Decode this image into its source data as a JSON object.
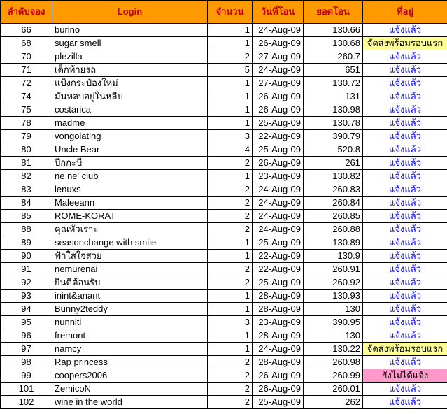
{
  "headers": {
    "order": "ลำดับจอง",
    "login": "Login",
    "qty": "จำนวน",
    "date": "วันที่โอน",
    "amount": "ยอดโอน",
    "status": "ที่อยู่"
  },
  "colors": {
    "header_bg": "#ff9900",
    "header_text": "#c00000",
    "status_text": "#0000ff",
    "pending_bg": "#ffff99",
    "unreported_bg": "#ff99cc"
  },
  "rows": [
    {
      "order": "66",
      "login": "burino",
      "qty": "1",
      "date": "24-Aug-09",
      "amount": "130.66",
      "status": "แจ้งแล้ว",
      "flag": ""
    },
    {
      "order": "68",
      "login": "sugar smell",
      "qty": "1",
      "date": "26-Aug-09",
      "amount": "130.68",
      "status": "จัดส่งพร้อมรอบแรก",
      "flag": "pending"
    },
    {
      "order": "70",
      "login": "plezilla",
      "qty": "2",
      "date": "27-Aug-09",
      "amount": "260.7",
      "status": "แจ้งแล้ว",
      "flag": ""
    },
    {
      "order": "71",
      "login": "เด็กท้ายรถ",
      "qty": "5",
      "date": "24-Aug-09",
      "amount": "651",
      "status": "แจ้งแล้ว",
      "flag": ""
    },
    {
      "order": "72",
      "login": "แป้งกระป๋องใหม่",
      "qty": "1",
      "date": "27-Aug-09",
      "amount": "130.72",
      "status": "แจ้งแล้ว",
      "flag": ""
    },
    {
      "order": "74",
      "login": "มันหลบอยู่ในหลืบ",
      "qty": "1",
      "date": "26-Aug-09",
      "amount": "131",
      "status": "แจ้งแล้ว",
      "flag": ""
    },
    {
      "order": "75",
      "login": "costarica",
      "qty": "1",
      "date": "26-Aug-09",
      "amount": "130.98",
      "status": "แจ้งแล้ว",
      "flag": ""
    },
    {
      "order": "78",
      "login": "madme",
      "qty": "1",
      "date": "25-Aug-09",
      "amount": "130.78",
      "status": "แจ้งแล้ว",
      "flag": ""
    },
    {
      "order": "79",
      "login": "vongolating",
      "qty": "3",
      "date": "22-Aug-09",
      "amount": "390.79",
      "status": "แจ้งแล้ว",
      "flag": ""
    },
    {
      "order": "80",
      "login": "Uncle Bear",
      "qty": "4",
      "date": "25-Aug-09",
      "amount": "520.8",
      "status": "แจ้งแล้ว",
      "flag": ""
    },
    {
      "order": "81",
      "login": "ปีกกะบี",
      "qty": "2",
      "date": "26-Aug-09",
      "amount": "261",
      "status": "แจ้งแล้ว",
      "flag": ""
    },
    {
      "order": "82",
      "login": "ne ne' club",
      "qty": "1",
      "date": "23-Aug-09",
      "amount": "130.82",
      "status": "แจ้งแล้ว",
      "flag": ""
    },
    {
      "order": "83",
      "login": "lenuxs",
      "qty": "2",
      "date": "24-Aug-09",
      "amount": "260.83",
      "status": "แจ้งแล้ว",
      "flag": ""
    },
    {
      "order": "84",
      "login": "Maleeann",
      "qty": "2",
      "date": "24-Aug-09",
      "amount": "260.84",
      "status": "แจ้งแล้ว",
      "flag": ""
    },
    {
      "order": "85",
      "login": "ROME-KORAT",
      "qty": "2",
      "date": "24-Aug-09",
      "amount": "260.85",
      "status": "แจ้งแล้ว",
      "flag": ""
    },
    {
      "order": "88",
      "login": "คุณหัวเราะ",
      "qty": "2",
      "date": "24-Aug-09",
      "amount": "260.88",
      "status": "แจ้งแล้ว",
      "flag": ""
    },
    {
      "order": "89",
      "login": "seasonchange with smile",
      "qty": "1",
      "date": "25-Aug-09",
      "amount": "130.89",
      "status": "แจ้งแล้ว",
      "flag": ""
    },
    {
      "order": "90",
      "login": "ฟ้าใสใจสวย",
      "qty": "1",
      "date": "22-Aug-09",
      "amount": "130.9",
      "status": "แจ้งแล้ว",
      "flag": ""
    },
    {
      "order": "91",
      "login": "nemurenai",
      "qty": "2",
      "date": "22-Aug-09",
      "amount": "260.91",
      "status": "แจ้งแล้ว",
      "flag": ""
    },
    {
      "order": "92",
      "login": "ยินดีต้อนรับ",
      "qty": "2",
      "date": "25-Aug-09",
      "amount": "260.92",
      "status": "แจ้งแล้ว",
      "flag": ""
    },
    {
      "order": "93",
      "login": "inint&anant",
      "qty": "1",
      "date": "28-Aug-09",
      "amount": "130.93",
      "status": "แจ้งแล้ว",
      "flag": ""
    },
    {
      "order": "94",
      "login": "Bunny2teddy",
      "qty": "1",
      "date": "28-Aug-09",
      "amount": "130",
      "status": "แจ้งแล้ว",
      "flag": ""
    },
    {
      "order": "95",
      "login": "nunniti",
      "qty": "3",
      "date": "23-Aug-09",
      "amount": "390.95",
      "status": "แจ้งแล้ว",
      "flag": ""
    },
    {
      "order": "96",
      "login": "fremont",
      "qty": "1",
      "date": "28-Aug-09",
      "amount": "130",
      "status": "แจ้งแล้ว",
      "flag": ""
    },
    {
      "order": "97",
      "login": "namcy",
      "qty": "1",
      "date": "24-Aug-09",
      "amount": "130.22",
      "status": "จัดส่งพร้อมรอบแรก",
      "flag": "pending"
    },
    {
      "order": "98",
      "login": "Rap princess",
      "qty": "2",
      "date": "28-Aug-09",
      "amount": "260.98",
      "status": "แจ้งแล้ว",
      "flag": ""
    },
    {
      "order": "99",
      "login": "coopers2006",
      "qty": "2",
      "date": "26-Aug-09",
      "amount": "260.99",
      "status": "ยังไม่ได้แจ้ง",
      "flag": "unreported"
    },
    {
      "order": "101",
      "login": "ZemicoN",
      "qty": "2",
      "date": "26-Aug-09",
      "amount": "260.01",
      "status": "แจ้งแล้ว",
      "flag": ""
    },
    {
      "order": "102",
      "login": "wine in the world",
      "qty": "2",
      "date": "25-Aug-09",
      "amount": "262",
      "status": "แจ้งแล้ว",
      "flag": ""
    }
  ]
}
